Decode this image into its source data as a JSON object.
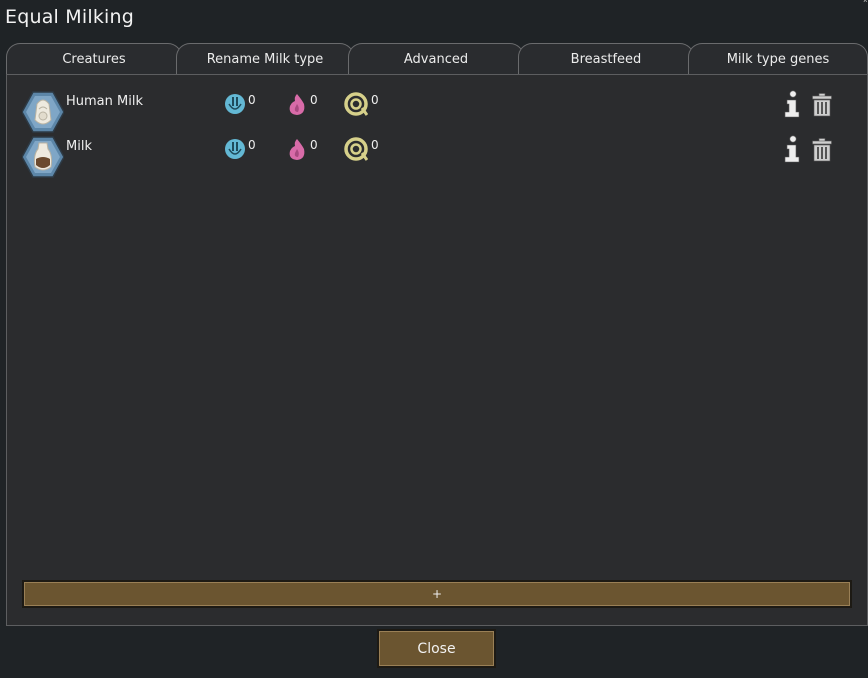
{
  "window": {
    "title": "Equal Milking",
    "corner_mark": "˄"
  },
  "tabs": [
    {
      "label": "Creatures"
    },
    {
      "label": "Rename Milk type"
    },
    {
      "label": "Advanced"
    },
    {
      "label": "Breastfeed"
    },
    {
      "label": "Milk type genes"
    }
  ],
  "milk_types": [
    {
      "name": "Human Milk",
      "icon": "human-milk-icon",
      "stats": [
        {
          "icon": "blue-power-icon",
          "value": "0",
          "color": "#63b8d4"
        },
        {
          "icon": "pink-flame-icon",
          "value": "0",
          "color": "#d86ba8"
        },
        {
          "icon": "yellow-spiral-icon",
          "value": "0",
          "color": "#d6d08a"
        }
      ]
    },
    {
      "name": "Milk",
      "icon": "milk-bottle-icon",
      "stats": [
        {
          "icon": "blue-power-icon",
          "value": "0",
          "color": "#63b8d4"
        },
        {
          "icon": "pink-flame-icon",
          "value": "0",
          "color": "#d86ba8"
        },
        {
          "icon": "yellow-spiral-icon",
          "value": "0",
          "color": "#d6d08a"
        }
      ]
    }
  ],
  "add_button": {
    "label": "+"
  },
  "close_button": {
    "label": "Close"
  },
  "colors": {
    "background": "#1f2326",
    "panel": "#2b2c2e",
    "button": "#6b5530"
  }
}
